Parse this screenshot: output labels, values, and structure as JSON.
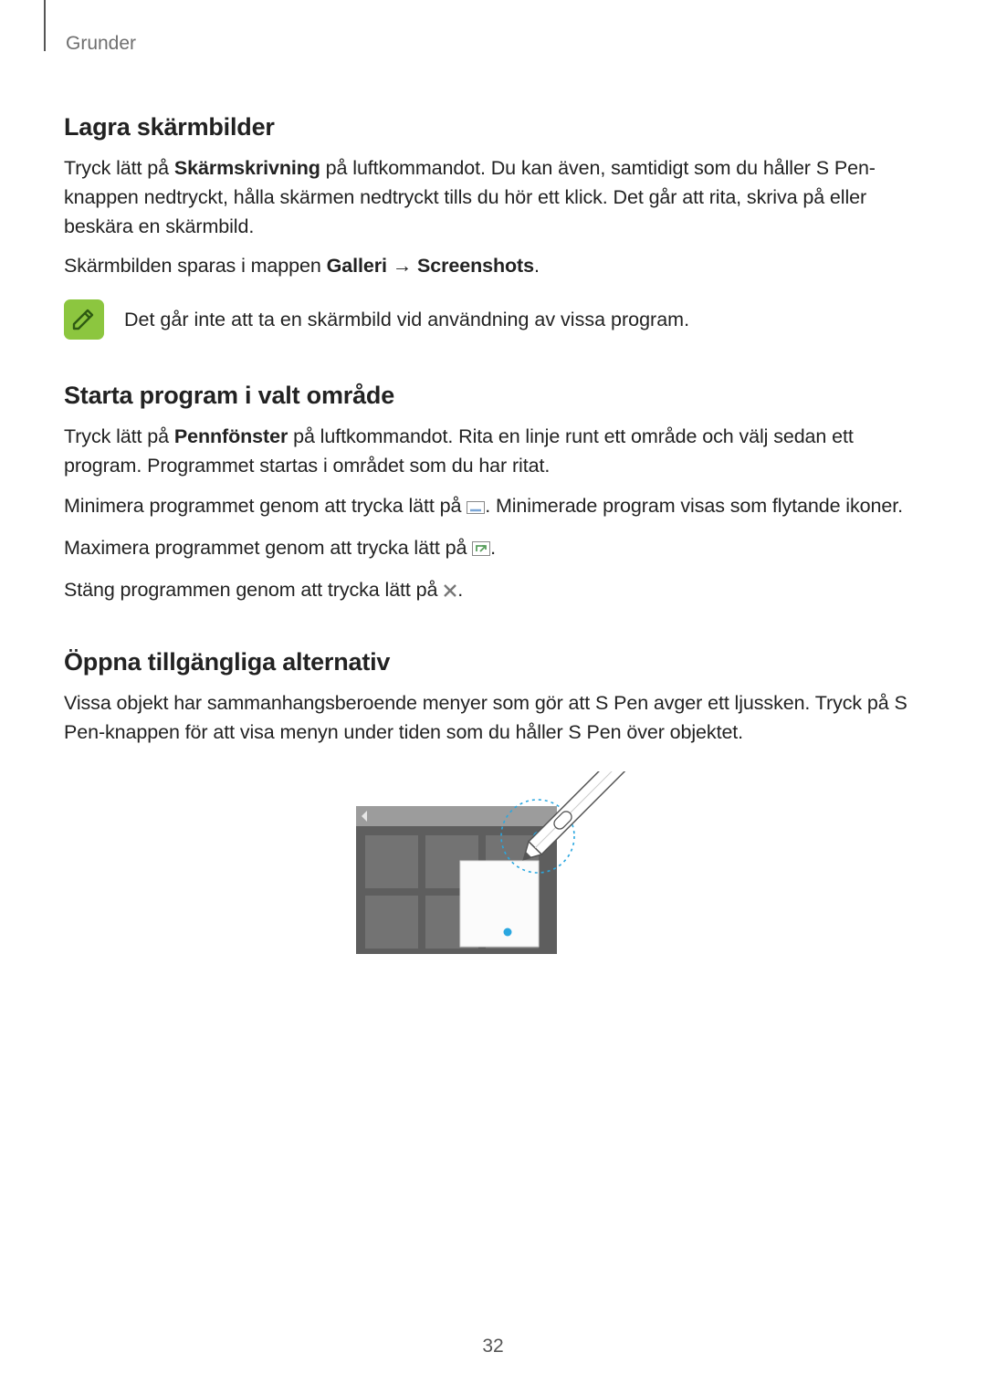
{
  "section_label": "Grunder",
  "page_number": "32",
  "h_lagra": "Lagra skärmbilder",
  "p_lagra_1a": "Tryck lätt på ",
  "p_lagra_1b": "Skärmskrivning",
  "p_lagra_1c": " på luftkommandot. Du kan även, samtidigt som du håller S Pen-knappen nedtryckt, hålla skärmen nedtryckt tills du hör ett klick. Det går att rita, skriva på eller beskära en skärmbild.",
  "p_lagra_2a": "Skärmbilden sparas i mappen ",
  "p_lagra_2b": "Galleri",
  "p_lagra_2c": " → ",
  "p_lagra_2d": "Screenshots",
  "p_lagra_2e": ".",
  "note_text": "Det går inte att ta en skärmbild vid användning av vissa program.",
  "h_starta": "Starta program i valt område",
  "p_starta_1a": "Tryck lätt på ",
  "p_starta_1b": "Pennfönster",
  "p_starta_1c": " på luftkommandot. Rita en linje runt ett område och välj sedan ett program. Programmet startas i området som du har ritat.",
  "p_starta_2a": "Minimera programmet genom att trycka lätt på ",
  "p_starta_2b": ". Minimerade program visas som flytande ikoner.",
  "p_starta_3a": "Maximera programmet genom att trycka lätt på ",
  "p_starta_3b": ".",
  "p_starta_4a": "Stäng programmen genom att trycka lätt på ",
  "p_starta_4b": ".",
  "h_oppna": "Öppna tillgängliga alternativ",
  "p_oppna_1": "Vissa objekt har sammanhangsberoende menyer som gör att S Pen avger ett ljussken. Tryck på S Pen-knappen för att visa menyn under tiden som du håller S Pen över objektet.",
  "icons": {
    "minimize": "minimize-icon",
    "maximize": "maximize-icon",
    "close": "close-icon",
    "note": "note-icon"
  }
}
